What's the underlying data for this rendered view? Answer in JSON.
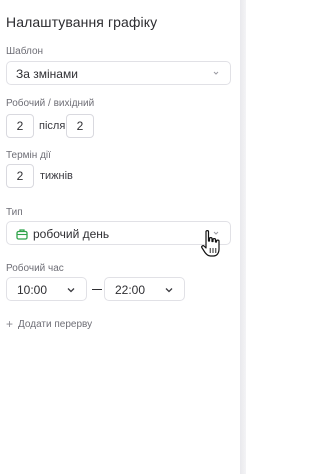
{
  "panel": {
    "title": "Налаштування графіку"
  },
  "template": {
    "label": "Шаблон",
    "value": "За змінами"
  },
  "work_off": {
    "label": "Робочий / вихідний",
    "work": "2",
    "after": "після",
    "off": "2"
  },
  "period": {
    "label": "Термін дії",
    "value": "2",
    "unit": "тижнів"
  },
  "type": {
    "label": "Тип",
    "value": "робочий день",
    "icon": "briefcase-icon",
    "icon_color": "#2fa34a"
  },
  "work_time": {
    "label": "Робочий час",
    "from": "10:00",
    "separator": "—",
    "to": "22:00"
  },
  "add_break": {
    "label": "Додати перерву",
    "icon": "plus-icon"
  }
}
